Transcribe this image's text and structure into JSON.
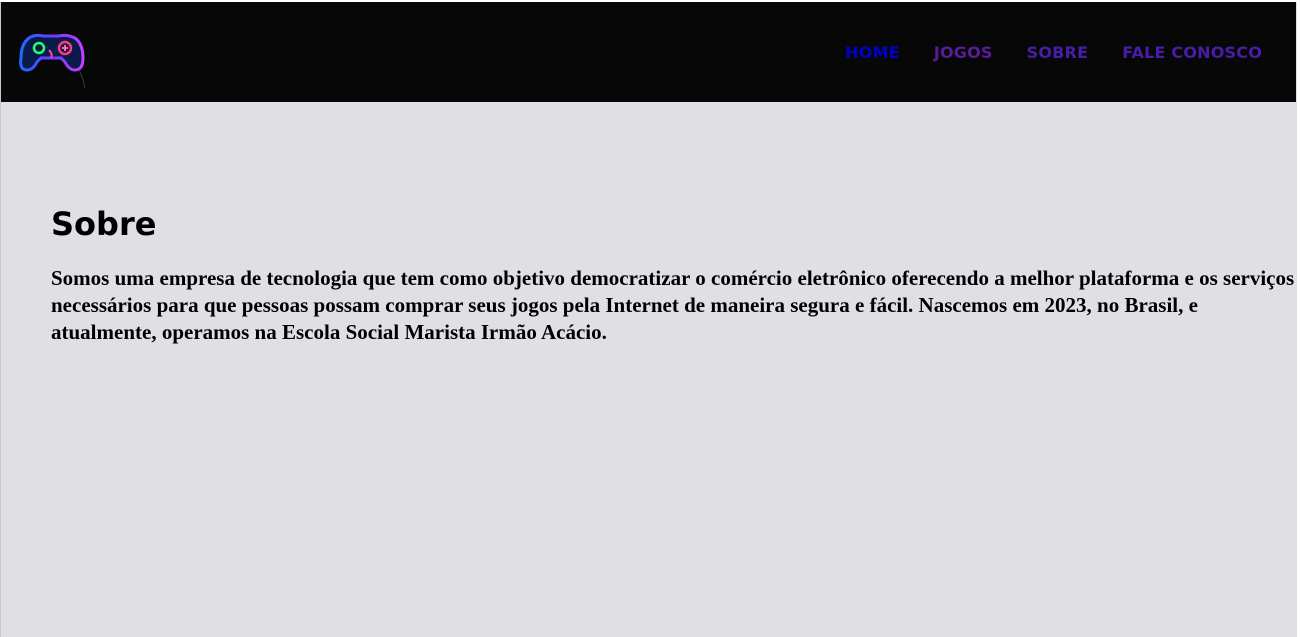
{
  "header": {
    "logo_icon": "gamepad-neon-icon",
    "nav": [
      {
        "label": "HOME",
        "color": "#0000cc"
      },
      {
        "label": "JOGOS",
        "color": "#5a1c9a"
      },
      {
        "label": "SOBRE",
        "color": "#4a1ca8"
      },
      {
        "label": "FALE CONOSCO",
        "color": "#4a1ca8"
      }
    ]
  },
  "main": {
    "title": "Sobre",
    "text": "Somos uma empresa de tecnologia que tem como objetivo democratizar o comércio eletrônico oferecendo a melhor plataforma e os serviços necessários para que pessoas possam comprar seus jogos pela Internet de maneira segura e fácil. Nascemos em 2023, no Brasil, e atualmente, operamos na Escola Social Marista Irmão Acácio."
  },
  "colors": {
    "header_bg": "#070707",
    "page_bg": "#e0dfe4"
  }
}
